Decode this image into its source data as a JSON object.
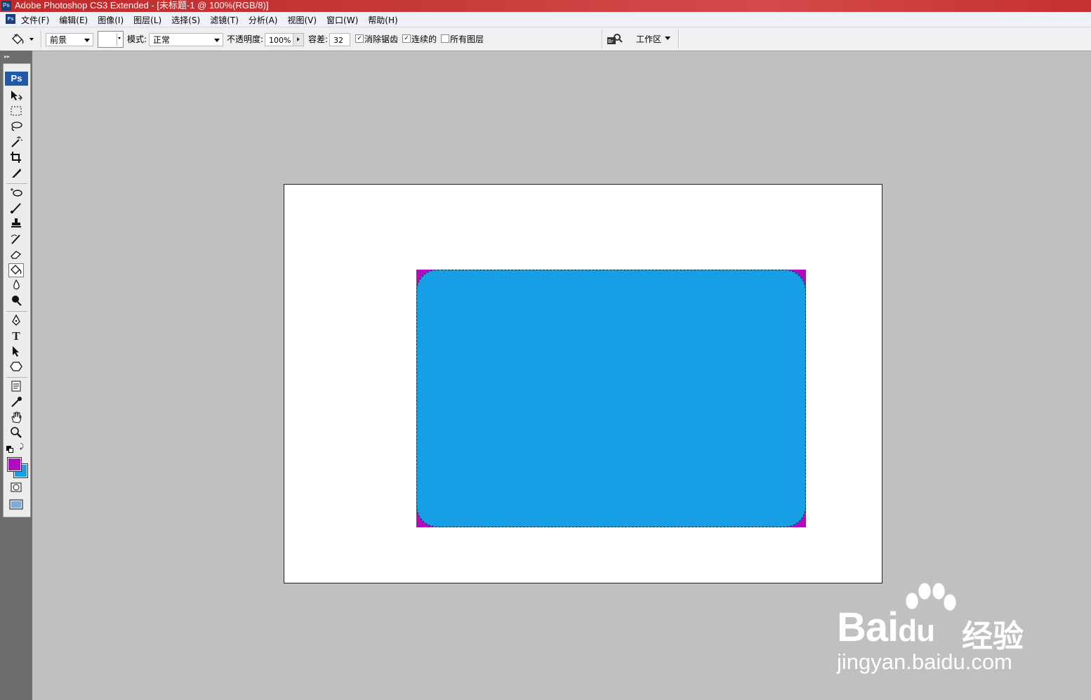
{
  "window": {
    "title": "Adobe Photoshop CS3 Extended - [未标题-1 @ 100%(RGB/8)]",
    "app_badge": "Ps"
  },
  "menu": {
    "items": [
      "文件(F)",
      "编辑(E)",
      "图像(I)",
      "图层(L)",
      "选择(S)",
      "滤镜(T)",
      "分析(A)",
      "视图(V)",
      "窗口(W)",
      "帮助(H)"
    ]
  },
  "options": {
    "fill_source": "前景",
    "mode_label": "模式:",
    "mode_value": "正常",
    "opacity_label": "不透明度:",
    "opacity_value": "100%",
    "tolerance_label": "容差:",
    "tolerance_value": "32",
    "antialias_label": "消除锯齿",
    "antialias_checked": true,
    "contiguous_label": "连续的",
    "contiguous_checked": true,
    "all_layers_label": "所有图层",
    "all_layers_checked": false,
    "workspace_label": "工作区"
  },
  "toolbox": {
    "badge": "Ps",
    "active_tool": "paint-bucket-tool",
    "foreground_color": "#b10dbf",
    "background_color": "#169fe4"
  },
  "canvas": {
    "background_color": "#ffffff",
    "shape_fill_color": "#169fe4",
    "corner_fill_color": "#b10dbf"
  },
  "watermark": {
    "brand": "Bai",
    "brand2": "du",
    "jingyan": "经验",
    "url": "jingyan.baidu.com"
  }
}
